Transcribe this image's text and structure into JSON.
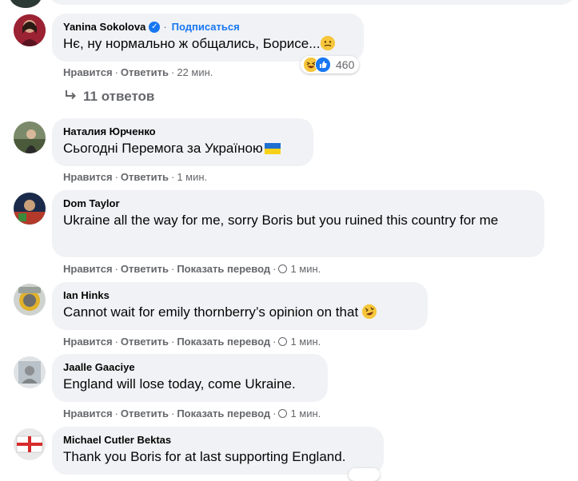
{
  "comments": [
    {
      "author": "Yanina Sokolova",
      "verified": true,
      "subscribe_label": "Подписаться",
      "text": "Нє, ну нормально ж общались, Борисе...",
      "emoji": "thinking-face",
      "like": "Нравится",
      "reply": "Ответить",
      "time": "22 мин.",
      "reaction_count": "460"
    },
    {
      "author": "Наталия Юрченко",
      "text": "Сьогодні Перемога за Україною",
      "emoji": "ukraine-flag",
      "like": "Нравится",
      "reply": "Ответить",
      "time": "1 мин."
    },
    {
      "author": "Dom Taylor",
      "text": "Ukraine all the way for me, sorry Boris but you ruined this country for me",
      "like": "Нравится",
      "reply": "Ответить",
      "translate": "Показать перевод",
      "time": "1 мин."
    },
    {
      "author": "Ian Hinks",
      "text": "Cannot wait for emily thornberry’s opinion on that",
      "emoji": "rolling-laughing-face",
      "like": "Нравится",
      "reply": "Ответить",
      "translate": "Показать перевод",
      "time": "1 мин."
    },
    {
      "author": "Jaalle Gaaciye",
      "text": "England will lose today, come Ukraine.",
      "like": "Нравится",
      "reply": "Ответить",
      "translate": "Показать перевод",
      "time": "1 мин."
    },
    {
      "author": "Michael Cutler Bektas",
      "text": "Thank you Boris for at last supporting England."
    }
  ],
  "replies_label": "11 ответов",
  "colors": {
    "bubble": "#f0f2f5",
    "link_blue": "#1877f2",
    "meta_gray": "#65676b"
  }
}
